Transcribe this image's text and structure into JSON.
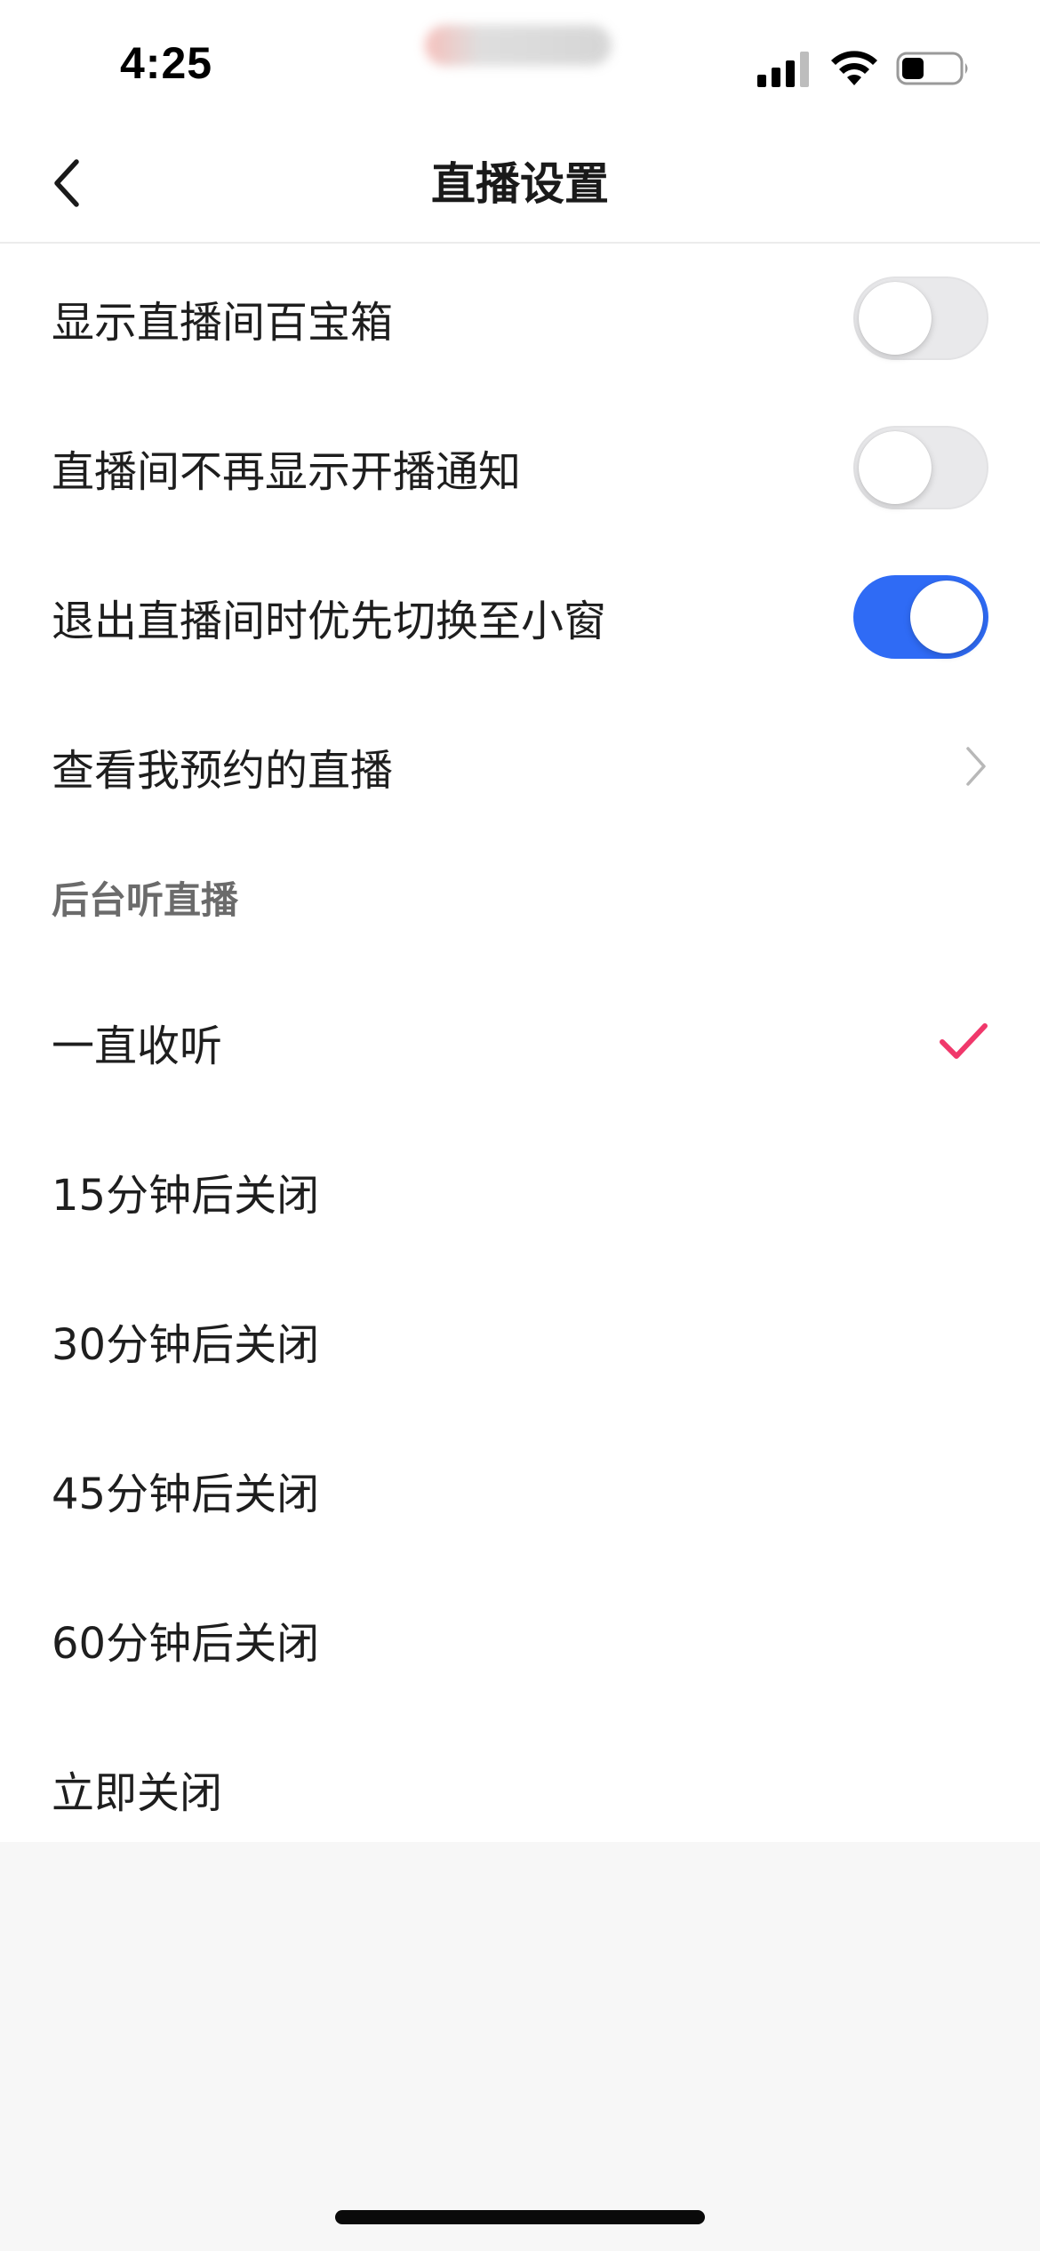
{
  "status_bar": {
    "time": "4:25",
    "icons": [
      "cellular-signal-icon",
      "wifi-icon",
      "battery-icon"
    ]
  },
  "nav": {
    "title": "直播设置",
    "back_icon": "chevron-left-icon"
  },
  "settings": [
    {
      "label": "显示直播间百宝箱",
      "control": "toggle",
      "on": false
    },
    {
      "label": "直播间不再显示开播通知",
      "control": "toggle",
      "on": false
    },
    {
      "label": "退出直播间时优先切换至小窗",
      "control": "toggle",
      "on": true
    },
    {
      "label": "查看我预约的直播",
      "control": "chevron"
    }
  ],
  "background_listen": {
    "header": "后台听直播",
    "options": [
      {
        "label": "一直收听",
        "selected": true
      },
      {
        "label": "15分钟后关闭",
        "selected": false
      },
      {
        "label": "30分钟后关闭",
        "selected": false
      },
      {
        "label": "45分钟后关闭",
        "selected": false
      },
      {
        "label": "60分钟后关闭",
        "selected": false
      },
      {
        "label": "立即关闭",
        "selected": false
      }
    ]
  },
  "colors": {
    "toggle_on": "#2f6bf5",
    "toggle_off": "#e9e9eb",
    "check": "#f0386b",
    "page_background": "#f7f7f7"
  }
}
